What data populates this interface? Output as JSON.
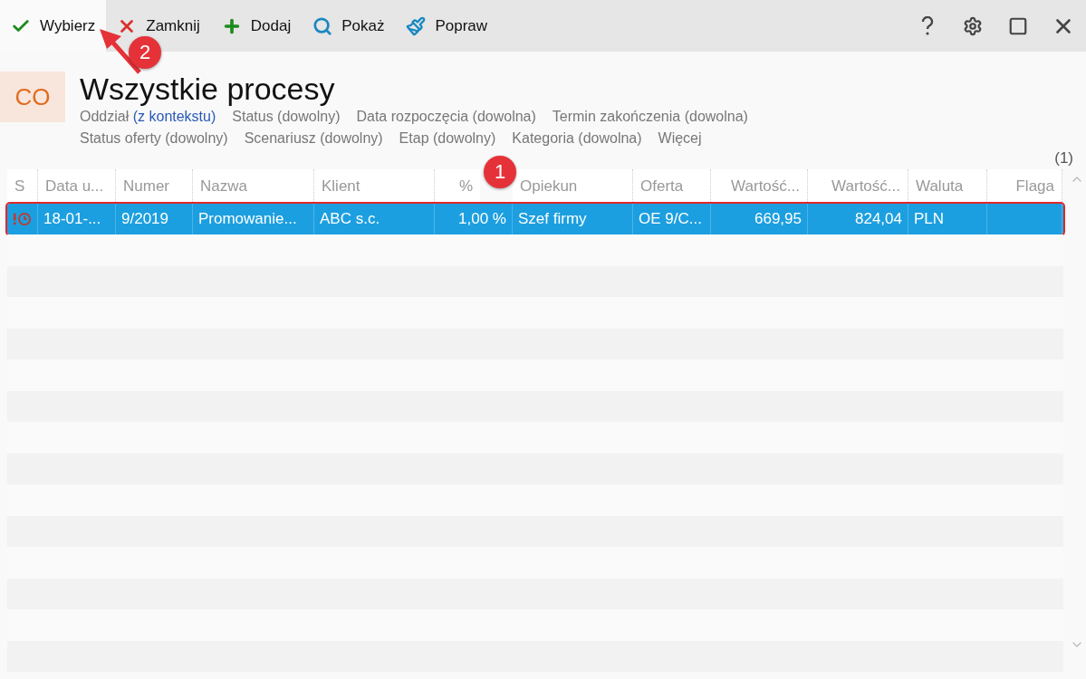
{
  "toolbar": {
    "actions": [
      {
        "label": "Wybierz",
        "highlighted": true
      },
      {
        "label": "Zamknij",
        "highlighted": false
      },
      {
        "label": "Dodaj",
        "highlighted": false
      },
      {
        "label": "Pokaż",
        "highlighted": false
      },
      {
        "label": "Popraw",
        "highlighted": false
      }
    ]
  },
  "header": {
    "badge": "CO",
    "title": "Wszystkie procesy",
    "count": "(1)"
  },
  "filters": [
    [
      {
        "label": "Oddział",
        "value": "(z kontekstu)",
        "set": true
      },
      {
        "label": "Status",
        "value": "(dowolny)",
        "set": false
      },
      {
        "label": "Data rozpoczęcia",
        "value": "(dowolna)",
        "set": false
      },
      {
        "label": "Termin zakończenia",
        "value": "(dowolna)",
        "set": false
      }
    ],
    [
      {
        "label": "Status oferty",
        "value": "(dowolny)",
        "set": false
      },
      {
        "label": "Scenariusz",
        "value": "(dowolny)",
        "set": false
      },
      {
        "label": "Etap",
        "value": "(dowolny)",
        "set": false
      },
      {
        "label": "Kategoria",
        "value": "(dowolna)",
        "set": false
      },
      {
        "label": "Więcej"
      }
    ]
  ],
  "table": {
    "columns": [
      {
        "label": "S",
        "kind": "text"
      },
      {
        "label": "Data u...",
        "kind": "text"
      },
      {
        "label": "Numer",
        "kind": "text"
      },
      {
        "label": "Nazwa",
        "kind": "text"
      },
      {
        "label": "Klient",
        "kind": "text"
      },
      {
        "label": "%",
        "kind": "number"
      },
      {
        "label": "Opiekun",
        "kind": "text"
      },
      {
        "label": "Oferta",
        "kind": "text"
      },
      {
        "label": "Wartość...",
        "kind": "number"
      },
      {
        "label": "Wartość...",
        "kind": "number"
      },
      {
        "label": "Waluta",
        "kind": "text"
      },
      {
        "label": "Flaga",
        "kind": "number"
      }
    ],
    "rows": [
      {
        "selected": true,
        "overdue": true,
        "cells": [
          "",
          "18-01-...",
          "9/2019",
          "Promowanie...",
          "ABC s.c.",
          "1,00 %",
          "Szef firmy",
          "OE 9/C...",
          "669,95",
          "824,04",
          "PLN",
          ""
        ]
      }
    ]
  },
  "annotations": [
    {
      "number": "1",
      "kind": "badge"
    },
    {
      "number": "2",
      "kind": "arrow"
    }
  ]
}
